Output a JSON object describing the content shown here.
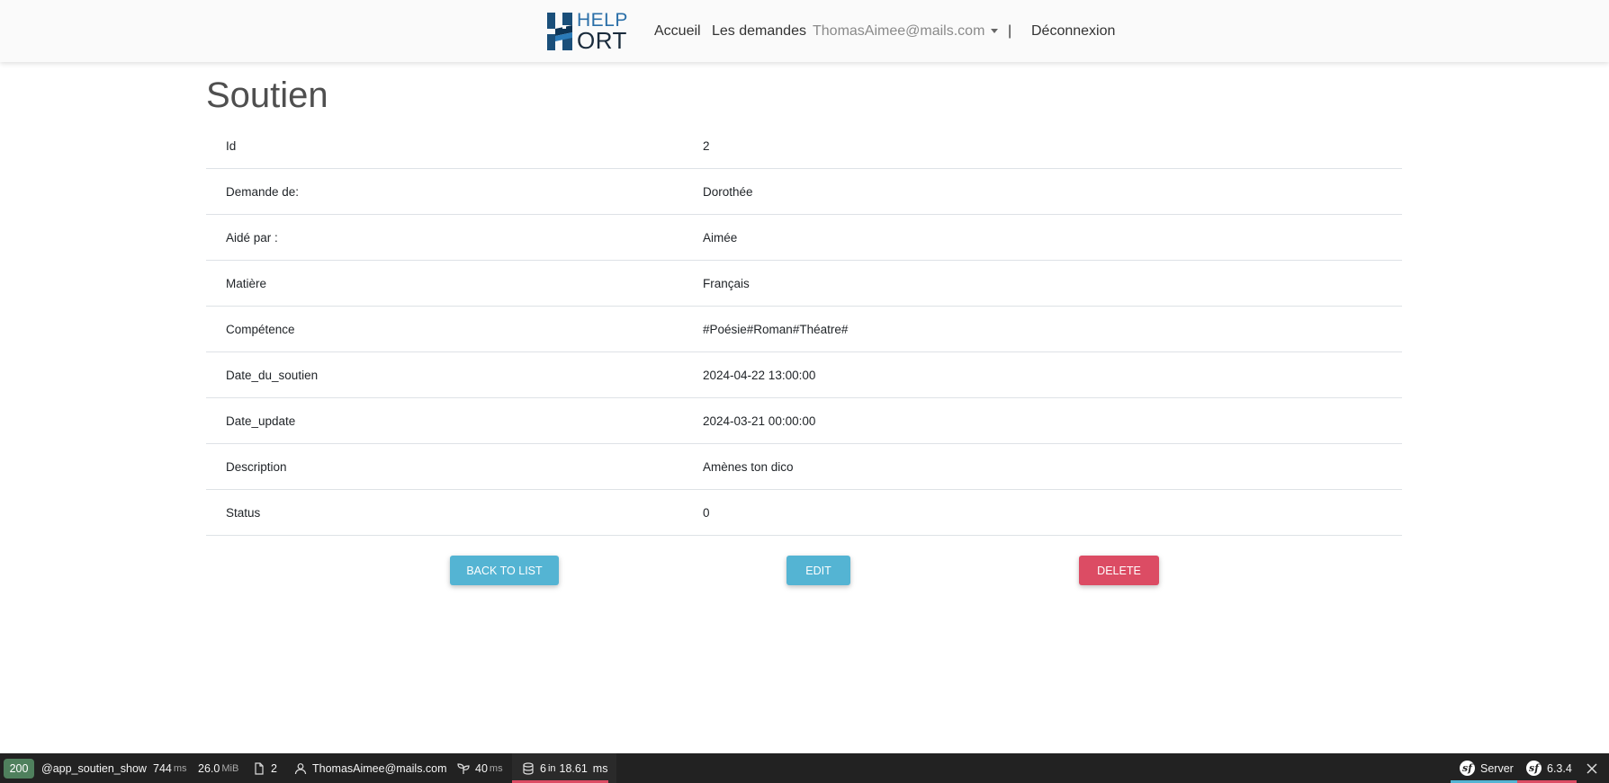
{
  "header": {
    "brand_top": "HELP",
    "brand_bottom": "ORT",
    "nav": {
      "home": "Accueil",
      "requests": "Les demandes",
      "user": "ThomasAimee@mails.com",
      "separator": "|",
      "logout": "Déconnexion"
    }
  },
  "page": {
    "title": "Soutien",
    "rows": [
      {
        "label": "Id",
        "value": "2"
      },
      {
        "label": "Demande de:",
        "value": "Dorothée"
      },
      {
        "label": "Aidé par :",
        "value": "Aimée"
      },
      {
        "label": "Matière",
        "value": "Français"
      },
      {
        "label": "Compétence",
        "value": "#Poésie#Roman#Théatre#"
      },
      {
        "label": "Date_du_soutien",
        "value": "2024-04-22 13:00:00"
      },
      {
        "label": "Date_update",
        "value": "2024-03-21 00:00:00"
      },
      {
        "label": "Description",
        "value": "Amènes ton dico"
      },
      {
        "label": "Status",
        "value": "0"
      }
    ],
    "buttons": {
      "back": "back to list",
      "edit": "edit",
      "delete": "delete"
    }
  },
  "debug_toolbar": {
    "status_code": "200",
    "route": "@app_soutien_show",
    "time_value": "744",
    "time_unit": "ms",
    "memory_value": "26.0",
    "memory_unit": "MiB",
    "files": "2",
    "user": "ThomasAimee@mails.com",
    "render_value": "40",
    "render_unit": "ms",
    "db_value": "6",
    "db_in": "in",
    "db_time": "18.61",
    "db_unit": "ms",
    "server": "Server",
    "version": "6.3.4",
    "colors": {
      "status_bg": "#4f805d",
      "db_underline": "#dc4c64",
      "server_underline": "#54b4d3",
      "version_underline": "#dc4c64"
    }
  },
  "colors": {
    "info": "#54b4d3",
    "danger": "#dc4c64",
    "brand_blue": "#1f5d8f"
  }
}
